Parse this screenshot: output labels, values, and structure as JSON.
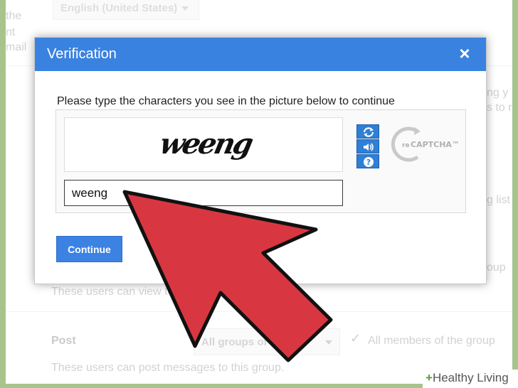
{
  "background": {
    "left_fragments": [
      "the",
      "nt",
      "mail"
    ],
    "right_fragments": [
      "ng y",
      "s to r",
      "g list",
      "oup"
    ],
    "language_select": "English (United States)",
    "view_text_fragment": "These users can view to",
    "post_label": "Post",
    "post_select_fragment": "groups of b",
    "post_select_prefix": "All",
    "post_option": "All members of the group",
    "post_description": "These users can post messages to this group."
  },
  "dialog": {
    "title": "Verification",
    "close_symbol": "×",
    "prompt": "Please type the characters you see in the picture below to continue",
    "captcha_word": "weeng",
    "input_value": "weeng",
    "continue_label": "Continue",
    "logo_text": "reCAPTCHA™",
    "logo_prefix": "re",
    "logo_suffix": "CAPTCHA™"
  },
  "controls": [
    "refresh-icon",
    "audio-icon",
    "help-icon"
  ],
  "watermark": {
    "symbol": "+",
    "text": "Healthy Living"
  },
  "colors": {
    "header": "#3a82e0",
    "button": "#3b82e3",
    "arrow": "#d83741",
    "frame": "#a6c48c"
  }
}
